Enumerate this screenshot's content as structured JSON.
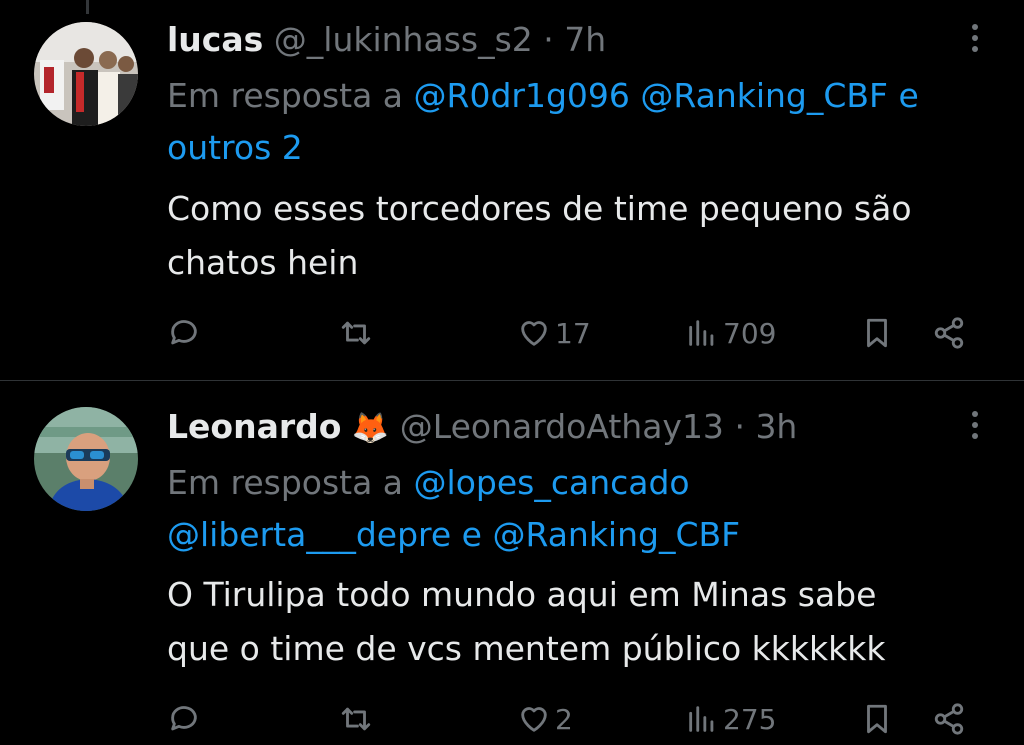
{
  "tweets": [
    {
      "name": "lucas",
      "handle": "@_lukinhass_s2",
      "dot": "·",
      "time": "7h",
      "reply_prefix": "Em resposta a",
      "reply_mentions": "@R0dr1g096 @Ranking_CBF e",
      "reply_mentions2": "outros 2",
      "text_line1": "Como esses torcedores de time pequeno são",
      "text_line2": "chatos hein",
      "likes": "17",
      "views": "709"
    },
    {
      "name": "Leonardo",
      "emoji": "🦊",
      "handle": "@LeonardoAthay13",
      "dot": "·",
      "time": "3h",
      "reply_prefix": "Em resposta a",
      "reply_mentions": "@lopes_cancado",
      "reply_mentions2a": "@liberta___depre",
      "reply_conj": "e",
      "reply_mentions2b": "@Ranking_CBF",
      "text_line1": "O Tirulipa todo mundo aqui em Minas sabe",
      "text_line2": "que o time de vcs mentem público kkkkkkk",
      "likes": "2",
      "views": "275"
    }
  ],
  "icons": {
    "reply": "reply-icon",
    "retweet": "retweet-icon",
    "like": "heart-icon",
    "views": "views-chart-icon",
    "bookmark": "bookmark-icon",
    "share": "share-icon",
    "more": "more-options-icon"
  },
  "colors": {
    "background": "#000000",
    "text": "#e7e9ea",
    "muted": "#71767b",
    "link": "#1d9bf0",
    "divider": "#2f3336"
  }
}
